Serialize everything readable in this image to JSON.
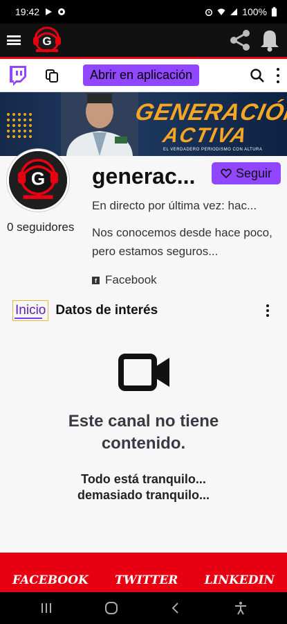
{
  "status_bar": {
    "time": "19:42",
    "battery": "100%"
  },
  "app_header": {
    "menu_icon": "hamburger-icon",
    "share_icon": "share-icon",
    "notifications_icon": "bell-icon"
  },
  "twitch_bar": {
    "open_app_label": "Abrir en aplicación"
  },
  "banner": {
    "title_line1": "GENERACIÓN",
    "title_line2": "ACTIVA",
    "tagline": "EL VERDADERO PERIODISMO CON ALTURA"
  },
  "channel": {
    "name": "generac...",
    "followers": "0 seguidores",
    "follow_label": "Seguir",
    "last_live": "En directo por última vez: hac...",
    "about": "Nos conocemos desde hace poco, pero estamos seguros...",
    "social_link": "Facebook"
  },
  "tabs": [
    {
      "label": "Inicio"
    },
    {
      "label": "Datos de interés"
    }
  ],
  "empty_state": {
    "title": "Este canal no tiene contenido.",
    "subtitle": "Todo está tranquilo... demasiado tranquilo..."
  },
  "footer": {
    "links": [
      "FACEBOOK",
      "TWITTER",
      "LINKEDIN"
    ]
  },
  "colors": {
    "twitch_purple": "#9147ff",
    "red": "#e60012",
    "gold": "#f5a623"
  }
}
